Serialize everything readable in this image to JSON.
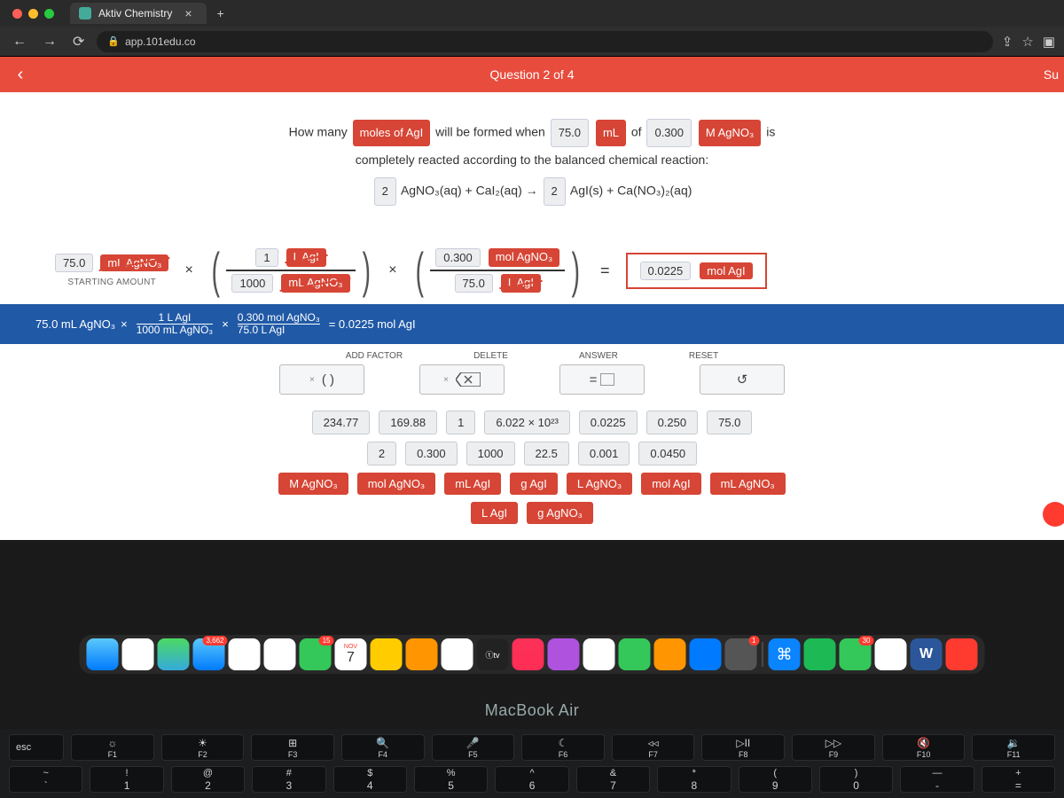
{
  "browser": {
    "tab_title": "Aktiv Chemistry",
    "tab_close": "×",
    "tab_add": "+",
    "url": "app.101edu.co",
    "nav": {
      "back": "←",
      "fwd": "→",
      "reload": "⟳"
    },
    "right": {
      "share": "⇪",
      "star": "☆",
      "window": "▣"
    }
  },
  "header": {
    "back": "‹",
    "title": "Question 2 of 4",
    "submit": "Su"
  },
  "prompt": {
    "pre": "How many ",
    "c1": "moles of AgI",
    "mid1": " will be formed when ",
    "c2": "75.0",
    "c3": "mL",
    "mid2": " of ",
    "c4": "0.300",
    "c5": "M AgNO₃",
    "post": " is",
    "line2": "completely reacted according to the balanced chemical reaction:",
    "eq_c1": "2",
    "eq_t1": "AgNO₃(aq) + CaI₂(aq) →",
    "eq_c2": "2",
    "eq_t2": "AgI(s) + Ca(NO₃)₂(aq)"
  },
  "work": {
    "start_val": "75.0",
    "start_unit": "mL AgNO₃",
    "start_label": "STARTING AMOUNT",
    "f1": {
      "tn": "1",
      "tu": "L AgI",
      "bn": "1000",
      "bu": "mL AgNO₃"
    },
    "f2": {
      "tn": "0.300",
      "tu": "mol AgNO₃",
      "bn": "75.0",
      "bu": "L AgI"
    },
    "ans_val": "0.0225",
    "ans_unit": "mol AgI",
    "times": "×",
    "eq": "="
  },
  "strip": {
    "a": "75.0 mL AgNO₃",
    "b_top": "1 L AgI",
    "b_bot": "1000 mL AgNO₃",
    "c_top": "0.300 mol AgNO₃",
    "c_bot": "75.0 L AgI",
    "res": "= 0.0225 mol AgI",
    "x": "×"
  },
  "tools": {
    "hdr": {
      "add": "ADD FACTOR",
      "del": "DELETE",
      "ans": "ANSWER",
      "rst": "RESET"
    },
    "btn": {
      "add_x": "×",
      "add_p": "(  )",
      "del_x": "×",
      "ans_eq": "=",
      "rst": "↺"
    }
  },
  "factors": {
    "row1": [
      "234.77",
      "169.88",
      "1",
      "6.022 × 10²³",
      "0.0225",
      "0.250",
      "75.0"
    ],
    "row2": [
      "2",
      "0.300",
      "1000",
      "22.5",
      "0.001",
      "0.0450"
    ],
    "row3": [
      "M AgNO₃",
      "mol AgNO₃",
      "mL AgI",
      "g AgI",
      "L AgNO₃",
      "mol AgI",
      "mL AgNO₃"
    ],
    "row4": [
      "L AgI",
      "g AgNO₃"
    ]
  },
  "dock": {
    "cal_day": "7",
    "cal_month": "NOV",
    "cal_badge": "15",
    "mail_badge": "3,662",
    "sys_badge": "1",
    "msg_badge": "30",
    "tv": "ⓣtv"
  },
  "mba": "MacBook Air",
  "keys": {
    "esc": "esc",
    "fn": [
      {
        "s": "☼",
        "l": "F1"
      },
      {
        "s": "☀",
        "l": "F2"
      },
      {
        "s": "⊞",
        "l": "F3"
      },
      {
        "s": "🔍",
        "l": "F4"
      },
      {
        "s": "🎤",
        "l": "F5"
      },
      {
        "s": "☾",
        "l": "F6"
      },
      {
        "s": "◃◃",
        "l": "F7"
      },
      {
        "s": "▷II",
        "l": "F8"
      },
      {
        "s": "▷▷",
        "l": "F9"
      },
      {
        "s": "🔇",
        "l": "F10"
      },
      {
        "s": "🔉",
        "l": "F11"
      }
    ],
    "num": [
      {
        "t": "!",
        "b": "1"
      },
      {
        "t": "@",
        "b": "2"
      },
      {
        "t": "#",
        "b": "3"
      },
      {
        "t": "$",
        "b": "4"
      },
      {
        "t": "%",
        "b": "5"
      },
      {
        "t": "^",
        "b": "6"
      },
      {
        "t": "&",
        "b": "7"
      },
      {
        "t": "*",
        "b": "8"
      },
      {
        "t": "(",
        "b": "9"
      },
      {
        "t": ")",
        "b": "0"
      },
      {
        "t": "—",
        "b": "-"
      },
      {
        "t": "+",
        "b": "="
      }
    ],
    "tilde": {
      "t": "~",
      "b": "`"
    }
  }
}
